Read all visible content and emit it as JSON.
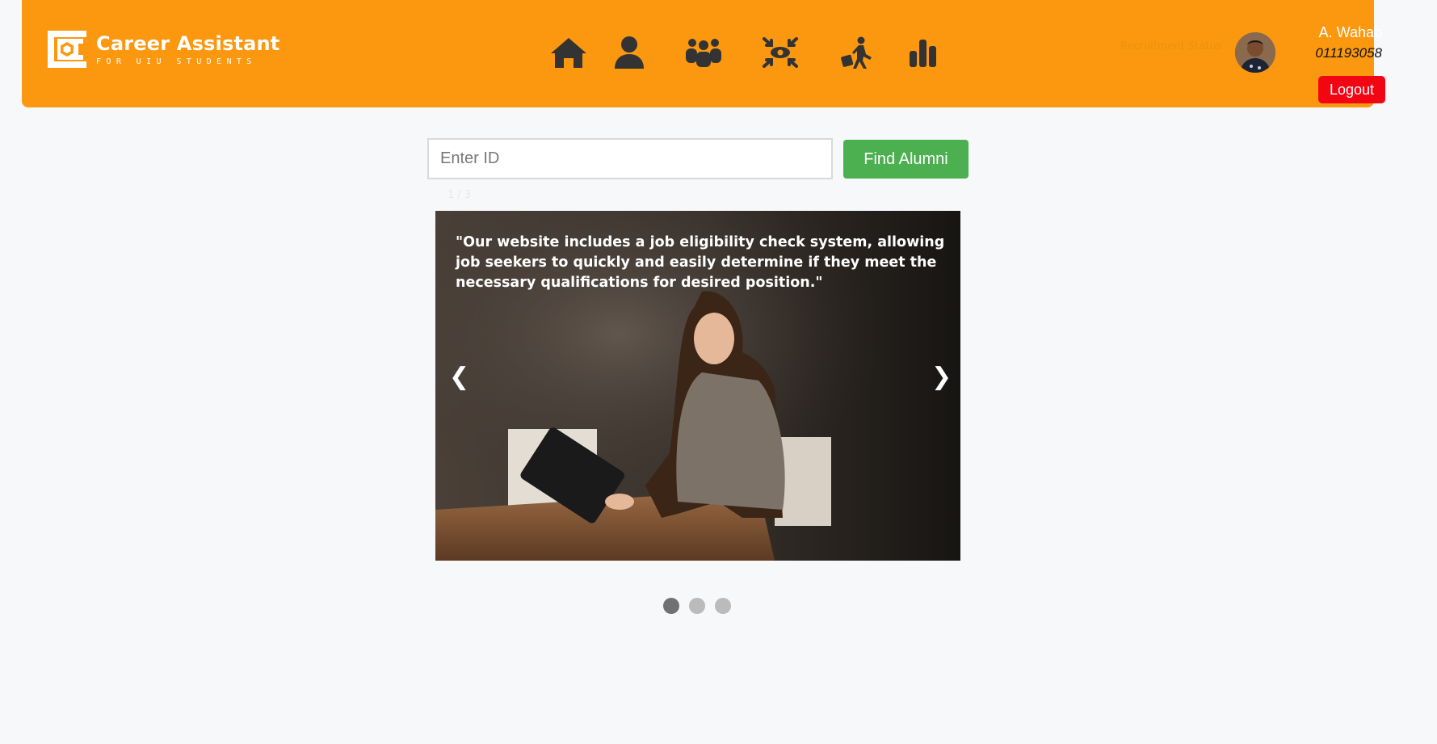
{
  "brand": {
    "title": "Career Assistant",
    "subtitle": "FOR UIU STUDENTS"
  },
  "nav": {
    "items": [
      {
        "name": "home-icon",
        "label": "Home"
      },
      {
        "name": "profile-icon",
        "label": "Profile"
      },
      {
        "name": "alumni-icon",
        "label": "Alumni"
      },
      {
        "name": "focus-icon",
        "label": "Eligibility"
      },
      {
        "name": "job-seeker-icon",
        "label": "Jobs"
      },
      {
        "name": "stats-icon",
        "label": "Statistics"
      }
    ]
  },
  "header": {
    "faint_label": "Recruitment Status"
  },
  "user": {
    "name": "A. Wahab",
    "id": "011193058",
    "logout_label": "Logout"
  },
  "search": {
    "placeholder": "Enter ID",
    "value": "",
    "button_label": "Find Alumni"
  },
  "slideshow": {
    "counter": "1 / 3",
    "caption": "\"Our website includes a job eligibility check system, allowing job seekers to quickly and easily determine if they meet the necessary qualifications for desired position.\"",
    "prev_label": "❮",
    "next_label": "❯",
    "total": 3,
    "active_index": 1
  },
  "colors": {
    "header_bg": "#fb980f",
    "icon": "#333333",
    "logout_bg": "#f20614",
    "find_button_bg": "#4caf50",
    "dot_active": "#717171",
    "dot_inactive": "#bbbbbb"
  }
}
